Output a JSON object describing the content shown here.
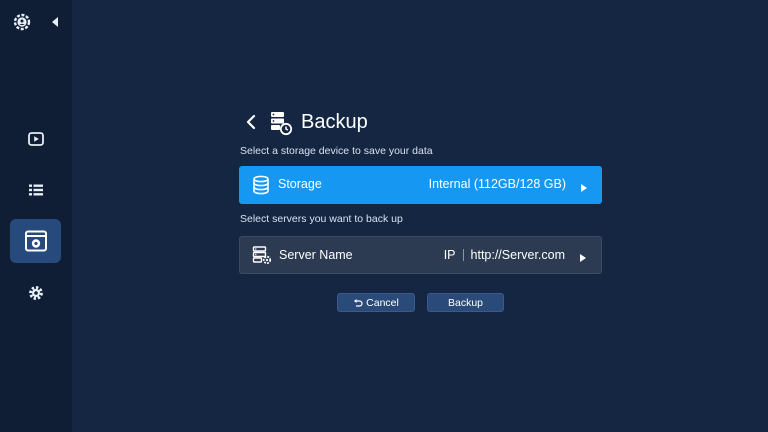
{
  "sidebar": {
    "top_icon": "settings-gear-icon",
    "collapse_icon": "triangle-left-icon",
    "items": [
      {
        "icon": "play-icon",
        "active": false
      },
      {
        "icon": "list-icon",
        "active": false
      },
      {
        "icon": "backup-panel-icon",
        "active": true
      },
      {
        "icon": "gear-icon",
        "active": false
      }
    ]
  },
  "header": {
    "title": "Backup",
    "back_icon": "chevron-left-icon",
    "title_icon": "server-backup-icon"
  },
  "storage_section": {
    "hint": "Select a storage device to save your data",
    "label": "Storage",
    "value": "Internal (112GB/128 GB)",
    "icon": "database-icon"
  },
  "server_section": {
    "hint": "Select servers you want to back up",
    "label": "Server Name",
    "ip_label": "IP",
    "ip_value": "http://Server.com",
    "icon": "server-settings-icon"
  },
  "buttons": {
    "cancel_label": "Cancel",
    "backup_label": "Backup"
  },
  "colors": {
    "background": "#152643",
    "sidebar": "#0f1d35",
    "accent": "#1698f2",
    "button": "#2a4a7a"
  }
}
